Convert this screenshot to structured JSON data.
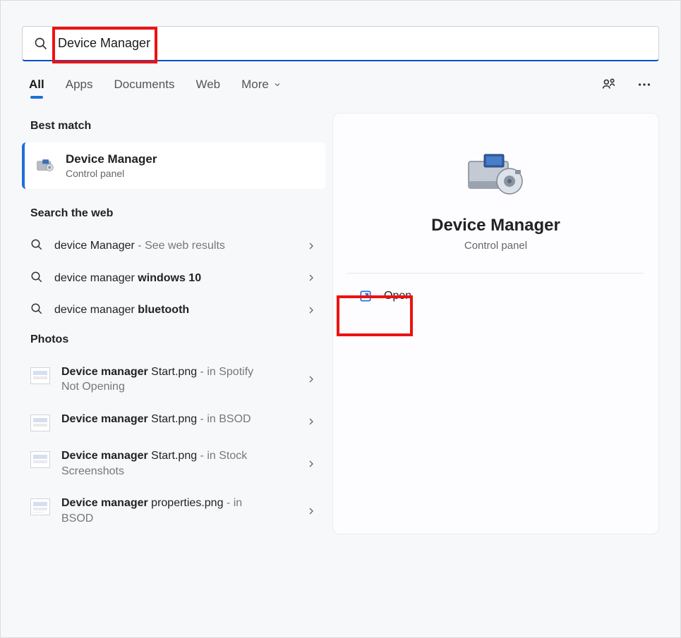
{
  "search": {
    "value": "Device Manager"
  },
  "tabs": {
    "items": [
      "All",
      "Apps",
      "Documents",
      "Web",
      "More"
    ],
    "active_index": 0
  },
  "sections": {
    "best_match": "Best match",
    "search_web": "Search the web",
    "photos": "Photos"
  },
  "best_match_item": {
    "title": "Device Manager",
    "subtitle": "Control panel"
  },
  "web_results": [
    {
      "prefix": "device Manager",
      "bold": "",
      "suffix": " - See web results"
    },
    {
      "prefix": "device manager ",
      "bold": "windows 10",
      "suffix": ""
    },
    {
      "prefix": "device manager ",
      "bold": "bluetooth",
      "suffix": ""
    }
  ],
  "photos": [
    {
      "name_bold": "Device manager",
      "name_rest": " Start.png",
      "loc": " - in Spotify Not Opening"
    },
    {
      "name_bold": "Device manager",
      "name_rest": " Start.png",
      "loc": " - in BSOD"
    },
    {
      "name_bold": "Device manager",
      "name_rest": " Start.png",
      "loc": " - in Stock Screenshots"
    },
    {
      "name_bold": "Device manager",
      "name_rest": " properties.png",
      "loc": " - in BSOD"
    }
  ],
  "preview": {
    "title": "Device Manager",
    "subtitle": "Control panel",
    "actions": {
      "open": "Open"
    }
  }
}
